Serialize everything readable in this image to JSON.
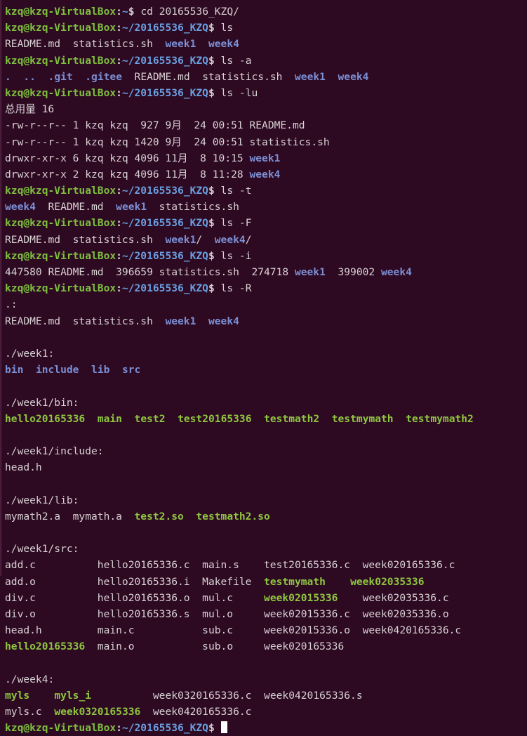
{
  "terminal": {
    "colors": {
      "background": "#2d0922",
      "foreground": "#d8d2d4",
      "prompt_user": "#7ec03e",
      "prompt_path": "#6a9fe0",
      "directory": "#7b8fd4",
      "executable": "#8ec63f",
      "cursor": "#ffffff"
    },
    "prompt": {
      "user_host_home": "kzq@kzq-VirtualBox",
      "path_home": "~",
      "path_project": "~/20165536_KZQ",
      "separator": ":",
      "symbol": "$"
    },
    "lines": [
      {
        "id": 0,
        "type": "prompt",
        "path": "~",
        "command": " cd 20165536_KZQ/"
      },
      {
        "id": 1,
        "type": "prompt",
        "path": "~/20165536_KZQ",
        "command": " ls"
      },
      {
        "id": 2,
        "type": "output",
        "segments": [
          {
            "text": "README.md  statistics.sh  ",
            "style": "plain"
          },
          {
            "text": "week1",
            "style": "dir"
          },
          {
            "text": "  ",
            "style": "plain"
          },
          {
            "text": "week4",
            "style": "dir"
          }
        ]
      },
      {
        "id": 3,
        "type": "prompt",
        "path": "~/20165536_KZQ",
        "command": " ls -a"
      },
      {
        "id": 4,
        "type": "output",
        "segments": [
          {
            "text": ".",
            "style": "dir"
          },
          {
            "text": "  ",
            "style": "plain"
          },
          {
            "text": "..",
            "style": "dir"
          },
          {
            "text": "  ",
            "style": "plain"
          },
          {
            "text": ".git",
            "style": "dir"
          },
          {
            "text": "  ",
            "style": "plain"
          },
          {
            "text": ".gitee",
            "style": "dir"
          },
          {
            "text": "  README.md  statistics.sh  ",
            "style": "plain"
          },
          {
            "text": "week1",
            "style": "dir"
          },
          {
            "text": "  ",
            "style": "plain"
          },
          {
            "text": "week4",
            "style": "dir"
          }
        ]
      },
      {
        "id": 5,
        "type": "prompt",
        "path": "~/20165536_KZQ",
        "command": " ls -lu"
      },
      {
        "id": 6,
        "type": "output",
        "segments": [
          {
            "text": "总用量 16",
            "style": "plain"
          }
        ]
      },
      {
        "id": 7,
        "type": "output",
        "segments": [
          {
            "text": "-rw-r--r-- 1 kzq kzq  927 9月  24 00:51 README.md",
            "style": "plain"
          }
        ]
      },
      {
        "id": 8,
        "type": "output",
        "segments": [
          {
            "text": "-rw-r--r-- 1 kzq kzq 1420 9月  24 00:51 statistics.sh",
            "style": "plain"
          }
        ]
      },
      {
        "id": 9,
        "type": "output",
        "segments": [
          {
            "text": "drwxr-xr-x 6 kzq kzq 4096 11月  8 10:15 ",
            "style": "plain"
          },
          {
            "text": "week1",
            "style": "dir"
          }
        ]
      },
      {
        "id": 10,
        "type": "output",
        "segments": [
          {
            "text": "drwxr-xr-x 2 kzq kzq 4096 11月  8 11:28 ",
            "style": "plain"
          },
          {
            "text": "week4",
            "style": "dir"
          }
        ]
      },
      {
        "id": 11,
        "type": "prompt",
        "path": "~/20165536_KZQ",
        "command": " ls -t"
      },
      {
        "id": 12,
        "type": "output",
        "segments": [
          {
            "text": "week4",
            "style": "dir"
          },
          {
            "text": "  README.md  ",
            "style": "plain"
          },
          {
            "text": "week1",
            "style": "dir"
          },
          {
            "text": "  statistics.sh",
            "style": "plain"
          }
        ]
      },
      {
        "id": 13,
        "type": "prompt",
        "path": "~/20165536_KZQ",
        "command": " ls -F"
      },
      {
        "id": 14,
        "type": "output",
        "segments": [
          {
            "text": "README.md  statistics.sh  ",
            "style": "plain"
          },
          {
            "text": "week1",
            "style": "dir"
          },
          {
            "text": "/  ",
            "style": "plain"
          },
          {
            "text": "week4",
            "style": "dir"
          },
          {
            "text": "/",
            "style": "plain"
          }
        ]
      },
      {
        "id": 15,
        "type": "prompt",
        "path": "~/20165536_KZQ",
        "command": " ls -i"
      },
      {
        "id": 16,
        "type": "output",
        "segments": [
          {
            "text": "447580 README.md  396659 statistics.sh  274718 ",
            "style": "plain"
          },
          {
            "text": "week1",
            "style": "dir"
          },
          {
            "text": "  399002 ",
            "style": "plain"
          },
          {
            "text": "week4",
            "style": "dir"
          }
        ]
      },
      {
        "id": 17,
        "type": "prompt",
        "path": "~/20165536_KZQ",
        "command": " ls -R"
      },
      {
        "id": 18,
        "type": "output",
        "segments": [
          {
            "text": ".:",
            "style": "plain"
          }
        ]
      },
      {
        "id": 19,
        "type": "output",
        "segments": [
          {
            "text": "README.md  statistics.sh  ",
            "style": "plain"
          },
          {
            "text": "week1",
            "style": "dir"
          },
          {
            "text": "  ",
            "style": "plain"
          },
          {
            "text": "week4",
            "style": "dir"
          }
        ]
      },
      {
        "id": 20,
        "type": "blank",
        "segments": []
      },
      {
        "id": 21,
        "type": "output",
        "segments": [
          {
            "text": "./week1:",
            "style": "plain"
          }
        ]
      },
      {
        "id": 22,
        "type": "output",
        "segments": [
          {
            "text": "bin",
            "style": "dir"
          },
          {
            "text": "  ",
            "style": "plain"
          },
          {
            "text": "include",
            "style": "dir"
          },
          {
            "text": "  ",
            "style": "plain"
          },
          {
            "text": "lib",
            "style": "dir"
          },
          {
            "text": "  ",
            "style": "plain"
          },
          {
            "text": "src",
            "style": "dir"
          }
        ]
      },
      {
        "id": 23,
        "type": "blank",
        "segments": []
      },
      {
        "id": 24,
        "type": "output",
        "segments": [
          {
            "text": "./week1/bin:",
            "style": "plain"
          }
        ]
      },
      {
        "id": 25,
        "type": "output",
        "segments": [
          {
            "text": "hello20165336",
            "style": "exec"
          },
          {
            "text": "  ",
            "style": "plain"
          },
          {
            "text": "main",
            "style": "exec"
          },
          {
            "text": "  ",
            "style": "plain"
          },
          {
            "text": "test2",
            "style": "exec"
          },
          {
            "text": "  ",
            "style": "plain"
          },
          {
            "text": "test20165336",
            "style": "exec"
          },
          {
            "text": "  ",
            "style": "plain"
          },
          {
            "text": "testmath2",
            "style": "exec"
          },
          {
            "text": "  ",
            "style": "plain"
          },
          {
            "text": "testmymath",
            "style": "exec"
          },
          {
            "text": "  ",
            "style": "plain"
          },
          {
            "text": "testmymath2",
            "style": "exec"
          }
        ]
      },
      {
        "id": 26,
        "type": "blank",
        "segments": []
      },
      {
        "id": 27,
        "type": "output",
        "segments": [
          {
            "text": "./week1/include:",
            "style": "plain"
          }
        ]
      },
      {
        "id": 28,
        "type": "output",
        "segments": [
          {
            "text": "head.h",
            "style": "plain"
          }
        ]
      },
      {
        "id": 29,
        "type": "blank",
        "segments": []
      },
      {
        "id": 30,
        "type": "output",
        "segments": [
          {
            "text": "./week1/lib:",
            "style": "plain"
          }
        ]
      },
      {
        "id": 31,
        "type": "output",
        "segments": [
          {
            "text": "mymath2.a  mymath.a  ",
            "style": "plain"
          },
          {
            "text": "test2.so",
            "style": "exec"
          },
          {
            "text": "  ",
            "style": "plain"
          },
          {
            "text": "testmath2.so",
            "style": "exec"
          }
        ]
      },
      {
        "id": 32,
        "type": "blank",
        "segments": []
      },
      {
        "id": 33,
        "type": "output",
        "segments": [
          {
            "text": "./week1/src:",
            "style": "plain"
          }
        ]
      },
      {
        "id": 34,
        "type": "output",
        "segments": [
          {
            "text": "add.c          hello20165336.c  main.s    test20165336.c  week020165336.c",
            "style": "plain"
          }
        ]
      },
      {
        "id": 35,
        "type": "output",
        "segments": [
          {
            "text": "add.o          hello20165336.i  Makefile  ",
            "style": "plain"
          },
          {
            "text": "testmymath",
            "style": "exec"
          },
          {
            "text": "    ",
            "style": "plain"
          },
          {
            "text": "week02035336",
            "style": "exec"
          }
        ]
      },
      {
        "id": 36,
        "type": "output",
        "segments": [
          {
            "text": "div.c          hello20165336.o  mul.c     ",
            "style": "plain"
          },
          {
            "text": "week02015336",
            "style": "exec"
          },
          {
            "text": "    week02035336.c",
            "style": "plain"
          }
        ]
      },
      {
        "id": 37,
        "type": "output",
        "segments": [
          {
            "text": "div.o          hello20165336.s  mul.o     week02015336.c  week02035336.o",
            "style": "plain"
          }
        ]
      },
      {
        "id": 38,
        "type": "output",
        "segments": [
          {
            "text": "head.h         main.c           sub.c     week02015336.o  week0420165336.c",
            "style": "plain"
          }
        ]
      },
      {
        "id": 39,
        "type": "output",
        "segments": [
          {
            "text": "hello20165336",
            "style": "exec"
          },
          {
            "text": "  main.o           sub.o     week020165336",
            "style": "plain"
          }
        ]
      },
      {
        "id": 40,
        "type": "blank",
        "segments": []
      },
      {
        "id": 41,
        "type": "output",
        "segments": [
          {
            "text": "./week4:",
            "style": "plain"
          }
        ]
      },
      {
        "id": 42,
        "type": "output",
        "segments": [
          {
            "text": "myls",
            "style": "exec"
          },
          {
            "text": "    ",
            "style": "plain"
          },
          {
            "text": "myls_i",
            "style": "exec"
          },
          {
            "text": "          week0320165336.c  week0420165336.s",
            "style": "plain"
          }
        ]
      },
      {
        "id": 43,
        "type": "output",
        "segments": [
          {
            "text": "myls.c  ",
            "style": "plain"
          },
          {
            "text": "week0320165336",
            "style": "exec"
          },
          {
            "text": "  week0420165336.c",
            "style": "plain"
          }
        ]
      },
      {
        "id": 44,
        "type": "prompt-cursor",
        "path": "~/20165536_KZQ",
        "command": " "
      }
    ]
  }
}
